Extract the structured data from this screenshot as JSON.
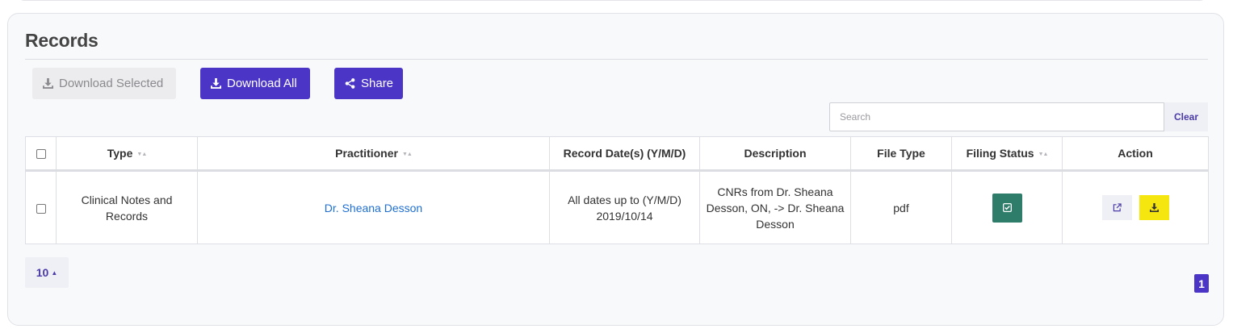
{
  "records": {
    "title": "Records",
    "toolbar": {
      "download_selected": "Download Selected",
      "download_all": "Download All",
      "share": "Share"
    },
    "search": {
      "placeholder": "Search",
      "value": "",
      "clear_label": "Clear"
    },
    "table": {
      "columns": [
        "Type",
        "Practitioner",
        "Record Date(s) (Y/M/D)",
        "Description",
        "File Type",
        "Filing Status",
        "Action"
      ],
      "sortable_columns": [
        "Type",
        "Practitioner",
        "Filing Status"
      ],
      "rows": [
        {
          "type": "Clinical Notes and Records",
          "practitioner": "Dr. Sheana Desson",
          "record_date_line1": "All dates up to (Y/M/D)",
          "record_date_line2": "2019/10/14",
          "description": "CNRs from Dr. Sheana Desson, ON,  -> Dr. Sheana Desson",
          "file_type": "pdf",
          "filing_status_icon": "check-square-icon",
          "checked": false
        }
      ]
    },
    "pagination": {
      "page_size": "10",
      "current_page": "1"
    },
    "colors": {
      "primary": "#4b35c7",
      "filing_status": "#2e7d6b",
      "download_highlight": "#f5e60f",
      "link": "#1f6fd1"
    }
  }
}
